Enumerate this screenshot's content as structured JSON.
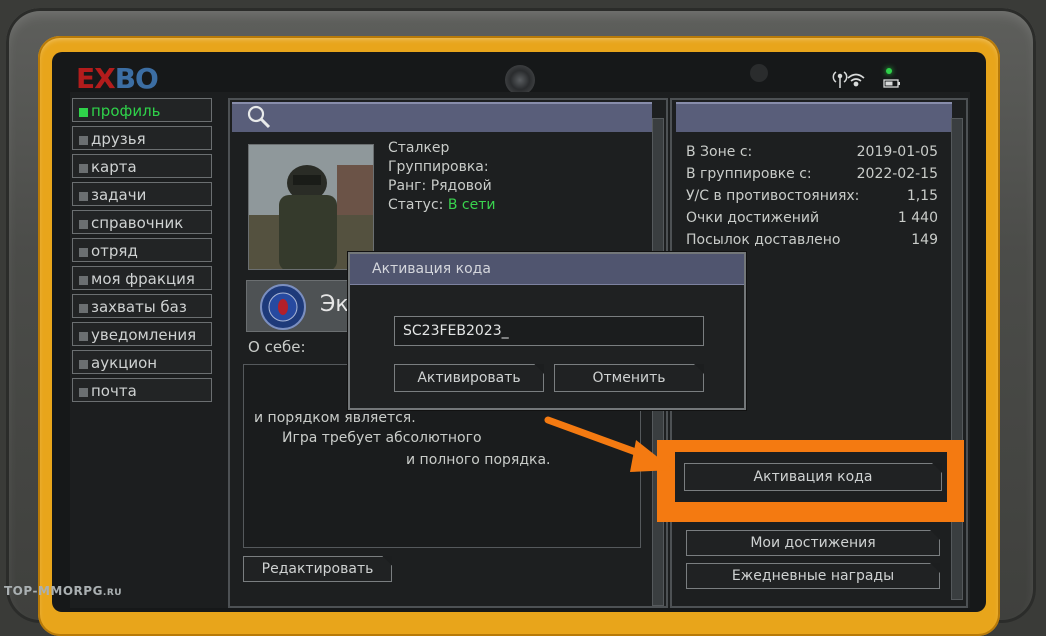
{
  "logo": {
    "ex": "EX",
    "bo": "BO"
  },
  "nav": {
    "items": [
      {
        "label": "профиль",
        "active": true
      },
      {
        "label": "друзья"
      },
      {
        "label": "карта"
      },
      {
        "label": "задачи"
      },
      {
        "label": "справочник"
      },
      {
        "label": "отряд"
      },
      {
        "label": "моя фракция"
      },
      {
        "label": "захваты баз"
      },
      {
        "label": "уведомления"
      },
      {
        "label": "аукцион"
      },
      {
        "label": "почта"
      }
    ]
  },
  "profile": {
    "name": "Сталкер",
    "faction_label": "Группировка:",
    "rank_label": "Ранг: Рядовой",
    "status_label": "Статус:",
    "status_value": "В сети",
    "faction_text": "Эк",
    "about_label": "О себе:",
    "about_lines": [
      "и порядком является.",
      "Игра требует абсолютного",
      "и полного порядка."
    ],
    "edit_button": "Редактировать"
  },
  "stats": [
    {
      "label": "В Зоне с:",
      "value": "2019-01-05"
    },
    {
      "label": "В группировке с:",
      "value": "2022-02-15"
    },
    {
      "label": "У/С в противостояниях:",
      "value": "1,15"
    },
    {
      "label": "Очки достижений",
      "value": "1 440"
    },
    {
      "label": "Посылок доставлено",
      "value": "149"
    }
  ],
  "right_buttons": {
    "activate": "Активация кода",
    "achievements": "Мои достижения",
    "daily": "Ежедневные награды"
  },
  "dialog": {
    "title": "Активация кода",
    "code_value": "SC23FEB2023_",
    "activate_button": "Активировать",
    "cancel_button": "Отменить"
  },
  "watermark": {
    "main": "TOP-MMORPG",
    "suffix": ".RU"
  },
  "colors": {
    "frame": "#e8a51b",
    "header_band": "#595e7a",
    "highlight": "#f47a11",
    "online": "#39d34e"
  }
}
